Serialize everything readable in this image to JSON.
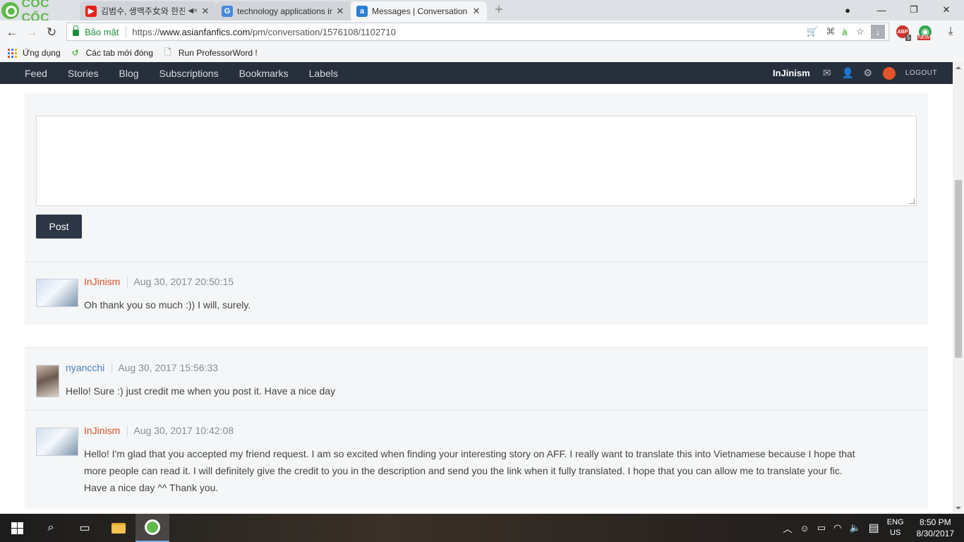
{
  "browser": {
    "brand": "CỐC CỐC",
    "tabs": [
      {
        "title": "김범수, 생맥주女와 한잔",
        "favicon": "youtube-icon",
        "color": "#e62117",
        "active": false,
        "muted": true
      },
      {
        "title": "technology applications in",
        "favicon": "google-translate-icon",
        "color": "#4a89dc",
        "active": false
      },
      {
        "title": "Messages | Conversation -",
        "favicon": "asianfanfics-icon",
        "color": "#2d7dd2",
        "active": true
      }
    ],
    "address": {
      "secure_label": "Bảo mật",
      "url_prefix": "https://",
      "url_domain": "www.asianfanfics.com",
      "url_path": "/pm/conversation/1576108/1102710"
    },
    "extensions": {
      "abp_count": "5",
      "new_badge": "NEW"
    },
    "bookmarks": [
      {
        "label": "Ứng dụng",
        "icon": "apps-grid-icon"
      },
      {
        "label": "Các tab mới đóng",
        "icon": "history-icon"
      },
      {
        "label": "Run ProfessorWord !",
        "icon": "page-icon"
      }
    ]
  },
  "site_nav": {
    "links": [
      "Feed",
      "Stories",
      "Blog",
      "Subscriptions",
      "Bookmarks",
      "Labels"
    ],
    "username": "InJinism",
    "logout": "LOGOUT"
  },
  "reply": {
    "textarea_value": "",
    "post_label": "Post"
  },
  "messages": [
    {
      "author": "InJinism",
      "date": "Aug 30, 2017 20:50:15",
      "body": "Oh thank you so much :)) I will, surely."
    },
    {
      "author": "nyancchi",
      "date": "Aug 30, 2017 15:56:33",
      "body": "Hello! Sure :) just credit me when you post it. Have a nice day"
    },
    {
      "author": "InJinism",
      "date": "Aug 30, 2017 10:42:08",
      "body_lines": [
        "Hello! I'm glad that you accepted my friend request. I am so excited when finding your interesting story on AFF. I really want to translate this into Vietnamese because I hope that",
        "more people can read it. I will definitely give the credit to you in the description and send you the link when it fully translated. I hope that you can allow me to translate your fic.",
        "Have a nice day ^^ Thank you."
      ]
    }
  ],
  "taskbar": {
    "language": [
      "ENG",
      "US"
    ],
    "time": "8:50 PM",
    "date": "8/30/2017"
  },
  "colors": {
    "nav_bg": "#262f3b",
    "author_orange": "#d9532b",
    "author_blue": "#4a7fbd",
    "post_button": "#2d3644",
    "brand_green": "#5fb94a"
  }
}
